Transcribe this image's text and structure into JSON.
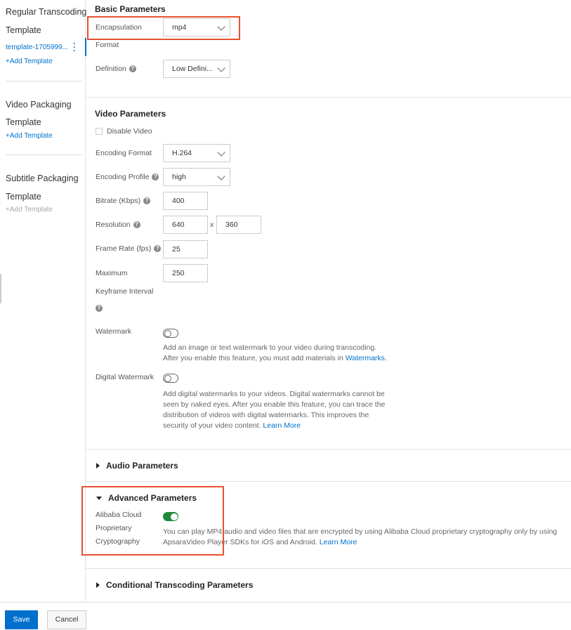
{
  "sidebar": {
    "regular": {
      "title_1": "Regular Transcoding",
      "title_2": "Template",
      "item": "template-1705999...",
      "add": "+Add Template"
    },
    "video": {
      "title_1": "Video Packaging",
      "title_2": "Template",
      "add": "+Add Template"
    },
    "subtitle": {
      "title_1": "Subtitle Packaging",
      "title_2": "Template",
      "add": "+Add Template"
    }
  },
  "basic": {
    "title": "Basic Parameters",
    "encapsulation_label_1": "Encapsulation",
    "encapsulation_label_2": "Format",
    "encapsulation_value": "mp4",
    "definition_label": "Definition",
    "definition_value": "Low Defini..."
  },
  "video": {
    "title": "Video Parameters",
    "disable_label": "Disable Video",
    "encoding_format_label": "Encoding Format",
    "encoding_format_value": "H.264",
    "encoding_profile_label": "Encoding Profile",
    "encoding_profile_value": "high",
    "bitrate_label": "Bitrate (Kbps)",
    "bitrate_value": "400",
    "resolution_label": "Resolution",
    "width_value": "640",
    "x_sep": "x",
    "height_value": "360",
    "frame_rate_label": "Frame Rate (fps)",
    "frame_rate_value": "25",
    "keyframe_label_1": "Maximum",
    "keyframe_label_2": "Keyframe Interval",
    "keyframe_value": "250",
    "watermark_label": "Watermark",
    "watermark_desc": "Add an image or text watermark to your video during transcoding. After you enable this feature, you must add materials in",
    "watermark_link": "Watermarks",
    "watermark_on": false,
    "digital_label": "Digital Watermark",
    "digital_desc": "Add digital watermarks to your videos. Digital watermarks cannot be seen by naked eyes. After you enable this feature, you can trace the distribution of videos with digital watermarks. This improves the security of your video content.",
    "digital_link": "Learn More",
    "digital_on": false
  },
  "audio": {
    "title": "Audio Parameters"
  },
  "advanced": {
    "title": "Advanced Parameters",
    "crypto_label_1": "Alibaba Cloud",
    "crypto_label_2": "Proprietary",
    "crypto_label_3": "Cryptography",
    "crypto_on": true,
    "crypto_desc": "You can play MP4 audio and video files that are encrypted by using Alibaba Cloud proprietary cryptography only by using ApsaraVideo Player SDKs for iOS and Android.",
    "crypto_link": "Learn More"
  },
  "conditional": {
    "title": "Conditional Transcoding Parameters"
  },
  "footer": {
    "save": "Save",
    "cancel": "Cancel"
  },
  "colors": {
    "accent": "#0070cc",
    "highlight": "#e8512f",
    "toggle_on": "#1f8a3c"
  }
}
